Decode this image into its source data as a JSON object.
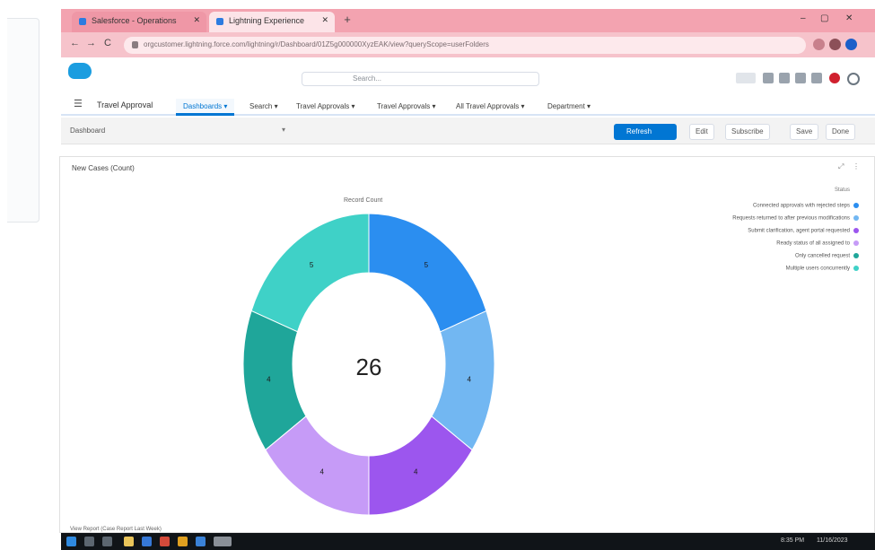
{
  "browser": {
    "tabs": [
      {
        "title": "Salesforce - Operations"
      },
      {
        "title": "Lightning Experience"
      }
    ],
    "new_tab": "+",
    "window_controls": [
      "–",
      "▢",
      "✕"
    ],
    "nav": [
      "←",
      "→",
      "C"
    ],
    "url": "orgcustomer.lightning.force.com/lightning/r/Dashboard/01Z5g000000XyzEAK/view?queryScope=userFolders"
  },
  "app": {
    "search_placeholder": "Search...",
    "app_name": "Travel Approval",
    "nav_items": [
      {
        "label": "Dashboards"
      },
      {
        "label": "Search"
      },
      {
        "label": "Travel Approvals"
      },
      {
        "label": "Travel Approvals"
      },
      {
        "label": "All Travel Approvals"
      },
      {
        "label": "Department"
      }
    ],
    "subheader": {
      "title": "Dashboard",
      "refresh_button": "Refresh",
      "buttons": [
        "Edit",
        "Subscribe",
        "Save",
        "Done"
      ]
    }
  },
  "dashboard": {
    "component_title": "New Cases (Count)",
    "chart_title": "Record Count",
    "legend_title": "Status",
    "footnote": "View Report (Case Report Last Week)"
  },
  "chart_data": {
    "type": "pie",
    "subtype": "donut",
    "total": 26,
    "slices": [
      {
        "value": 5,
        "color": "#2b8ef0"
      },
      {
        "value": 4,
        "color": "#72b7f2"
      },
      {
        "value": 4,
        "color": "#9c56ee"
      },
      {
        "value": 4,
        "color": "#c69bf7"
      },
      {
        "value": 4,
        "color": "#1fa69a"
      },
      {
        "value": 5,
        "color": "#3fd1c7"
      }
    ],
    "legend": [
      {
        "label": "Connected approvals with rejected steps",
        "color": "#2b8ef0"
      },
      {
        "label": "Requests returned to after previous modifications",
        "color": "#72b7f2"
      },
      {
        "label": "Submit clarification, agent portal requested",
        "color": "#9c56ee"
      },
      {
        "label": "Ready status of all assigned to",
        "color": "#c69bf7"
      },
      {
        "label": "Only cancelled request",
        "color": "#1fa69a"
      },
      {
        "label": "Multiple users concurrently",
        "color": "#3fd1c7"
      }
    ]
  },
  "taskbar": {
    "tray_time": "8:35 PM",
    "tray_date": "11/16/2023"
  }
}
